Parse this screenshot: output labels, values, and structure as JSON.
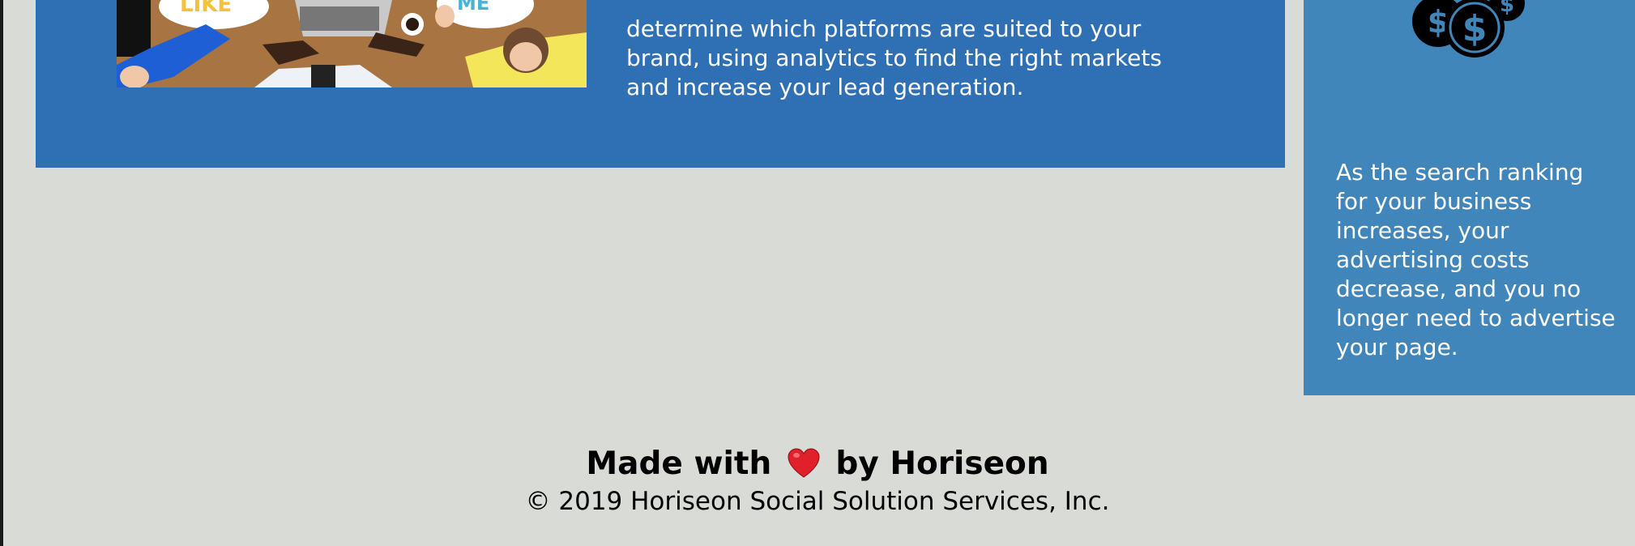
{
  "section": {
    "image_alt": "social media marketing team photo",
    "text": "determine which platforms are suited to your brand, using analytics to find the right markets and increase your lead generation."
  },
  "benefit": {
    "icon": "money-coins-icon",
    "text": "As the search ranking for your business increases, your advertising costs decrease, and you no longer need to advertise your page."
  },
  "footer": {
    "made_with": "Made with",
    "heart_icon": "heart-icon",
    "by": "by Horiseon",
    "copyright": "© 2019 Horiseon Social Solution Services, Inc."
  },
  "colors": {
    "page_bg": "#d9dcd6",
    "section_bg": "#2f70b5",
    "card_bg": "#4086ba",
    "heart": "#e0202a"
  }
}
